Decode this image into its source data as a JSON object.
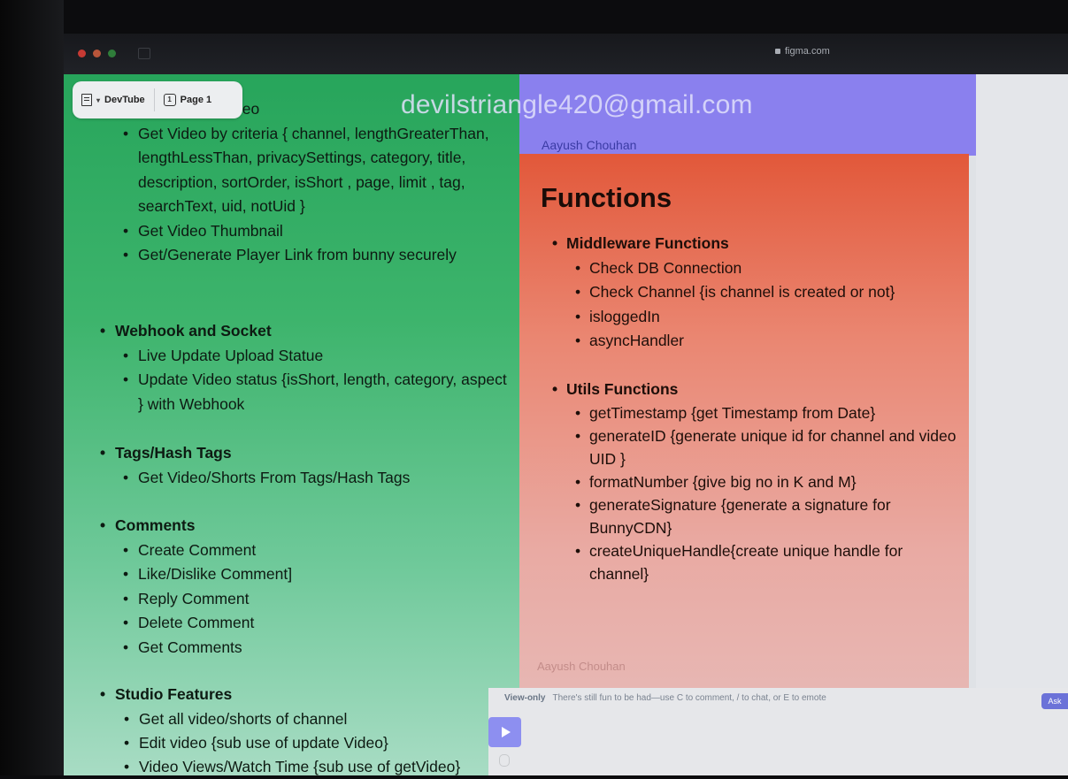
{
  "browser": {
    "url": "figma.com"
  },
  "toolbar": {
    "file_name": "DevTube",
    "page_label": "Page 1",
    "page_icon": "1"
  },
  "canvas": {
    "watermark_email": "devilstriangle420@gmail.com",
    "author": "Aayush Chouhan",
    "author_faint": "Aayush Chouhan"
  },
  "left": {
    "partial_heading": "deo",
    "video_items": [
      "Get Video by criteria { channel, lengthGreaterThan, lengthLessThan, privacySettings, category, title, description, sortOrder, isShort , page, limit , tag, searchText, uid, notUid }",
      "Get Video Thumbnail",
      "Get/Generate Player Link from bunny securely"
    ],
    "webhook": {
      "title": "Webhook and Socket",
      "items": [
        "Live Update Upload Statue",
        "Update Video status {isShort, length, category, aspect } with Webhook"
      ]
    },
    "tags": {
      "title": "Tags/Hash Tags",
      "items": [
        "Get Video/Shorts From Tags/Hash Tags"
      ]
    },
    "comments": {
      "title": "Comments",
      "items": [
        "Create Comment",
        "Like/Dislike Comment]",
        "Reply Comment",
        "Delete Comment",
        "Get Comments"
      ]
    },
    "studio": {
      "title": "Studio Features",
      "items": [
        "Get all video/shorts of channel",
        "Edit video {sub use of update Video}",
        "Video Views/Watch Time {sub use of getVideo}"
      ]
    }
  },
  "right": {
    "title": "Functions",
    "middleware": {
      "title": "Middleware Functions",
      "items": [
        "Check DB Connection",
        "Check Channel {is channel is created or not}",
        "isloggedIn",
        "asyncHandler"
      ]
    },
    "utils": {
      "title": "Utils Functions",
      "items": [
        "getTimestamp {get Timestamp from Date}",
        "generateID {generate unique id for channel and video UID }",
        "formatNumber {give big no in K and M}",
        "generateSignature {generate a signature for BunnyCDN}",
        "createUniqueHandle{create unique handle for channel}"
      ]
    }
  },
  "bottom": {
    "view_only": "View-only",
    "hint": "There's still fun to be had—use C to comment, / to chat, or E to emote",
    "ask": "Ask"
  }
}
